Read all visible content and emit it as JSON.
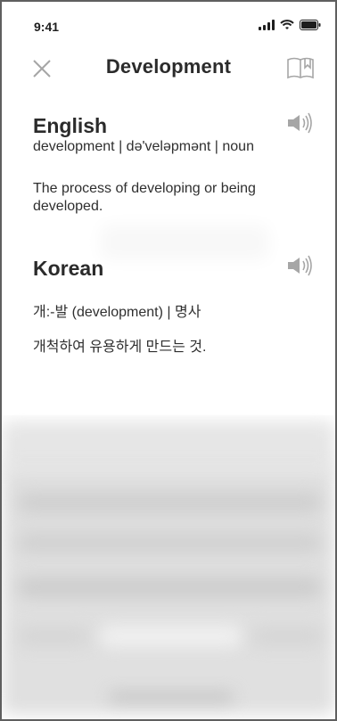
{
  "status_bar": {
    "time": "9:41"
  },
  "header": {
    "title": "Development"
  },
  "entries": [
    {
      "language": "English",
      "meta": "development | də'veləpmənt | noun",
      "definition": "The process of developing or being developed."
    },
    {
      "language": "Korean",
      "meta": "개:-발 (development) | 명사",
      "definition": "개척하여 유용하게 만드는 것."
    }
  ],
  "icons": {
    "close": "close-icon",
    "bookmark": "bookmark-icon",
    "speaker": "speaker-icon"
  },
  "colors": {
    "text": "#2b2b2b",
    "icon": "#a6a6a6",
    "frame": "#5f5f5f"
  }
}
